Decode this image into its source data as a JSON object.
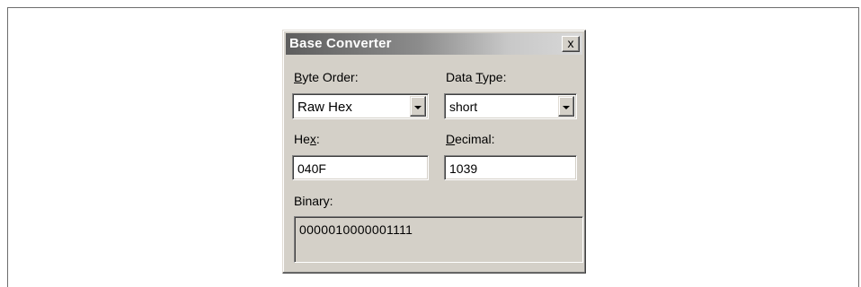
{
  "dialog": {
    "title": "Base Converter",
    "close_label": "x"
  },
  "byte_order": {
    "label_pre": "",
    "label_mnemonic": "B",
    "label_post": "yte Order:",
    "value": "Raw Hex"
  },
  "data_type": {
    "label_pre": "Data ",
    "label_mnemonic": "T",
    "label_post": "ype:",
    "value": "short"
  },
  "hex": {
    "label_pre": "He",
    "label_mnemonic": "x",
    "label_post": ":",
    "value": "040F"
  },
  "decimal": {
    "label_pre": "",
    "label_mnemonic": "D",
    "label_post": "ecimal:",
    "value": "1039"
  },
  "binary": {
    "label": "Binary:",
    "value": "0000010000001111"
  }
}
